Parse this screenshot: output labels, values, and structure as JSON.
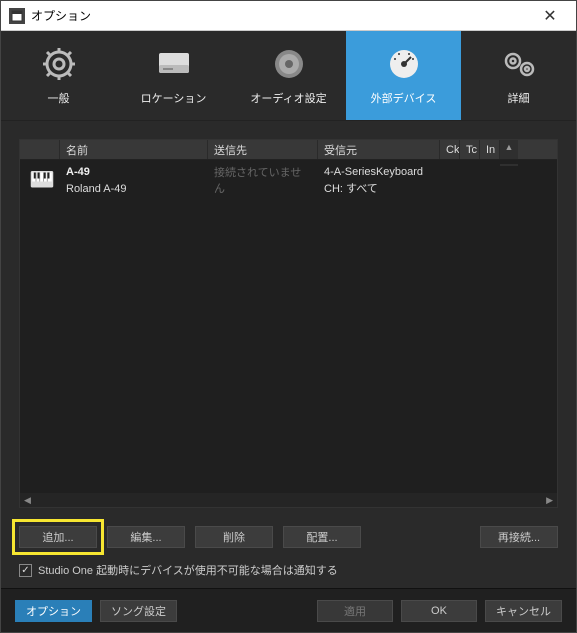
{
  "window": {
    "title": "オプション"
  },
  "tabs": {
    "general": "一般",
    "location": "ロケーション",
    "audio": "オーディオ設定",
    "external": "外部デバイス",
    "details": "詳細"
  },
  "table": {
    "headers": {
      "name": "名前",
      "send": "送信先",
      "recv": "受信元",
      "ck": "Ck",
      "tc": "Tc",
      "in": "In"
    },
    "device": {
      "name_bold": "A-49",
      "name_sub": "Roland A-49",
      "send": "接続されていません",
      "recv_line1": "4-A-SeriesKeyboard",
      "recv_line2": "CH: すべて"
    }
  },
  "buttons": {
    "add": "追加...",
    "edit": "編集...",
    "remove": "削除",
    "placement": "配置...",
    "reconnect": "再接続..."
  },
  "checkbox": {
    "label": "Studio One 起動時にデバイスが使用不可能な場合は通知する"
  },
  "footer": {
    "options": "オプション",
    "song_settings": "ソング設定",
    "apply": "適用",
    "ok": "OK",
    "cancel": "キャンセル"
  }
}
